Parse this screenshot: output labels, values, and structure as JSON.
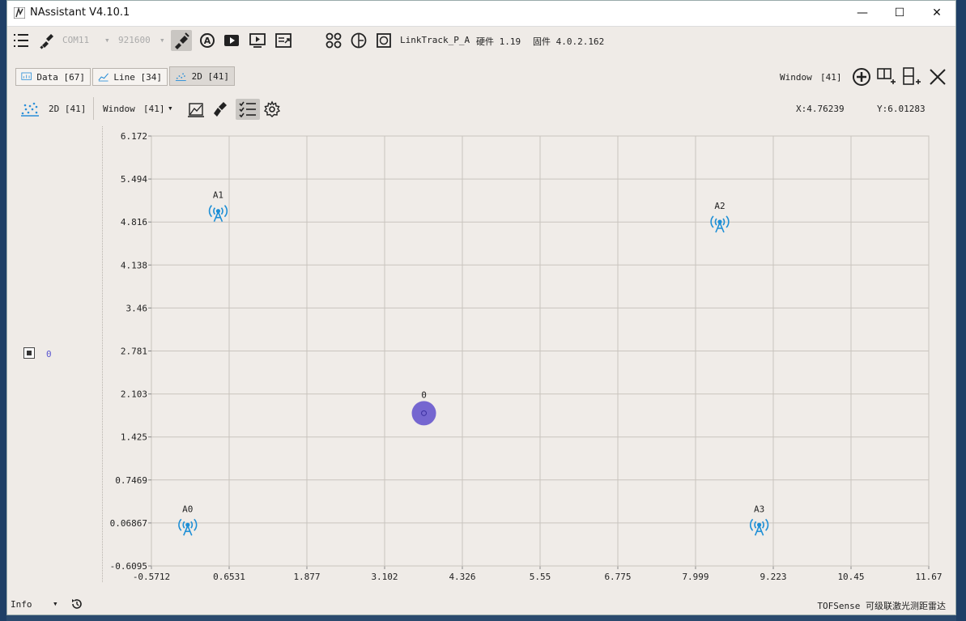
{
  "window": {
    "title": "NAssistant V4.10.1",
    "minimize_glyph": "—",
    "maximize_glyph": "☐",
    "close_glyph": "✕"
  },
  "toolbar": {
    "port": "COM11",
    "baud": "921600",
    "product": "LinkTrack_P_A",
    "hardware": "硬件 1.19",
    "firmware": "固件 4.0.2.162"
  },
  "tabs": [
    {
      "label": "Data [67]",
      "icon": "data-chart-icon"
    },
    {
      "label": "Line [34]",
      "icon": "line-chart-icon"
    },
    {
      "label": "2D [41]",
      "icon": "scatter-icon",
      "active": true
    }
  ],
  "right_controls": {
    "window_label": "Window",
    "window_value": "[41]"
  },
  "subbar": {
    "view_label": "2D [41]",
    "window_label": "Window",
    "window_value": "[41]",
    "x_readout": "X:4.76239",
    "y_readout": "Y:6.01283"
  },
  "legend": {
    "label": "0"
  },
  "chart_data": {
    "type": "scatter",
    "title": "",
    "xlabel": "",
    "ylabel": "",
    "xlim": [
      -0.5712,
      11.67
    ],
    "ylim": [
      -0.6095,
      6.172
    ],
    "x_ticks": [
      "-0.5712",
      "0.6531",
      "1.877",
      "3.102",
      "4.326",
      "5.55",
      "6.775",
      "7.999",
      "9.223",
      "10.45",
      "11.67"
    ],
    "y_ticks": [
      "6.172",
      "5.494",
      "4.816",
      "4.138",
      "3.46",
      "2.781",
      "2.103",
      "1.425",
      "0.7469",
      "0.06867",
      "-0.6095"
    ],
    "grid": true,
    "anchors": [
      {
        "name": "A0",
        "x": 0.0,
        "y": 0.0
      },
      {
        "name": "A1",
        "x": 0.48,
        "y": 4.95
      },
      {
        "name": "A2",
        "x": 8.38,
        "y": 4.78
      },
      {
        "name": "A3",
        "x": 9.0,
        "y": 0.0
      }
    ],
    "tags": [
      {
        "name": "0",
        "x": 3.72,
        "y": 1.8,
        "color": "#6a5acd"
      }
    ],
    "anchor_color": "#1e8fd6"
  },
  "statusbar": {
    "log_level": "Info",
    "product_text": "TOFSense 可级联激光测距雷达"
  }
}
